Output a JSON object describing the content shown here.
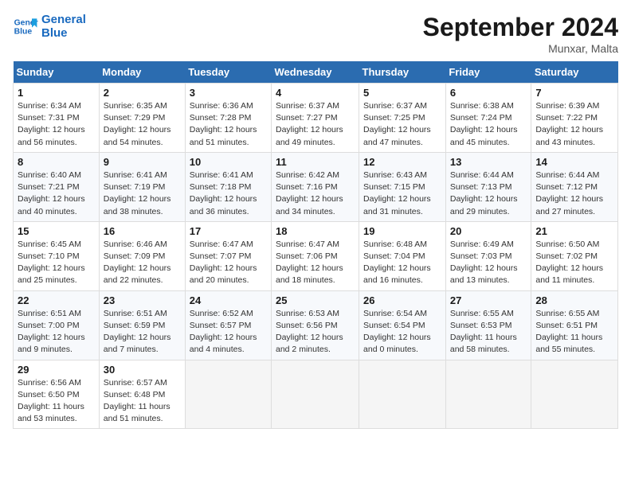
{
  "logo": {
    "line1": "General",
    "line2": "Blue"
  },
  "title": "September 2024",
  "location": "Munxar, Malta",
  "days_of_week": [
    "Sunday",
    "Monday",
    "Tuesday",
    "Wednesday",
    "Thursday",
    "Friday",
    "Saturday"
  ],
  "weeks": [
    [
      {
        "day": "1",
        "sunrise": "6:34 AM",
        "sunset": "7:31 PM",
        "daylight": "12 hours and 56 minutes."
      },
      {
        "day": "2",
        "sunrise": "6:35 AM",
        "sunset": "7:29 PM",
        "daylight": "12 hours and 54 minutes."
      },
      {
        "day": "3",
        "sunrise": "6:36 AM",
        "sunset": "7:28 PM",
        "daylight": "12 hours and 51 minutes."
      },
      {
        "day": "4",
        "sunrise": "6:37 AM",
        "sunset": "7:27 PM",
        "daylight": "12 hours and 49 minutes."
      },
      {
        "day": "5",
        "sunrise": "6:37 AM",
        "sunset": "7:25 PM",
        "daylight": "12 hours and 47 minutes."
      },
      {
        "day": "6",
        "sunrise": "6:38 AM",
        "sunset": "7:24 PM",
        "daylight": "12 hours and 45 minutes."
      },
      {
        "day": "7",
        "sunrise": "6:39 AM",
        "sunset": "7:22 PM",
        "daylight": "12 hours and 43 minutes."
      }
    ],
    [
      {
        "day": "8",
        "sunrise": "6:40 AM",
        "sunset": "7:21 PM",
        "daylight": "12 hours and 40 minutes."
      },
      {
        "day": "9",
        "sunrise": "6:41 AM",
        "sunset": "7:19 PM",
        "daylight": "12 hours and 38 minutes."
      },
      {
        "day": "10",
        "sunrise": "6:41 AM",
        "sunset": "7:18 PM",
        "daylight": "12 hours and 36 minutes."
      },
      {
        "day": "11",
        "sunrise": "6:42 AM",
        "sunset": "7:16 PM",
        "daylight": "12 hours and 34 minutes."
      },
      {
        "day": "12",
        "sunrise": "6:43 AM",
        "sunset": "7:15 PM",
        "daylight": "12 hours and 31 minutes."
      },
      {
        "day": "13",
        "sunrise": "6:44 AM",
        "sunset": "7:13 PM",
        "daylight": "12 hours and 29 minutes."
      },
      {
        "day": "14",
        "sunrise": "6:44 AM",
        "sunset": "7:12 PM",
        "daylight": "12 hours and 27 minutes."
      }
    ],
    [
      {
        "day": "15",
        "sunrise": "6:45 AM",
        "sunset": "7:10 PM",
        "daylight": "12 hours and 25 minutes."
      },
      {
        "day": "16",
        "sunrise": "6:46 AM",
        "sunset": "7:09 PM",
        "daylight": "12 hours and 22 minutes."
      },
      {
        "day": "17",
        "sunrise": "6:47 AM",
        "sunset": "7:07 PM",
        "daylight": "12 hours and 20 minutes."
      },
      {
        "day": "18",
        "sunrise": "6:47 AM",
        "sunset": "7:06 PM",
        "daylight": "12 hours and 18 minutes."
      },
      {
        "day": "19",
        "sunrise": "6:48 AM",
        "sunset": "7:04 PM",
        "daylight": "12 hours and 16 minutes."
      },
      {
        "day": "20",
        "sunrise": "6:49 AM",
        "sunset": "7:03 PM",
        "daylight": "12 hours and 13 minutes."
      },
      {
        "day": "21",
        "sunrise": "6:50 AM",
        "sunset": "7:02 PM",
        "daylight": "12 hours and 11 minutes."
      }
    ],
    [
      {
        "day": "22",
        "sunrise": "6:51 AM",
        "sunset": "7:00 PM",
        "daylight": "12 hours and 9 minutes."
      },
      {
        "day": "23",
        "sunrise": "6:51 AM",
        "sunset": "6:59 PM",
        "daylight": "12 hours and 7 minutes."
      },
      {
        "day": "24",
        "sunrise": "6:52 AM",
        "sunset": "6:57 PM",
        "daylight": "12 hours and 4 minutes."
      },
      {
        "day": "25",
        "sunrise": "6:53 AM",
        "sunset": "6:56 PM",
        "daylight": "12 hours and 2 minutes."
      },
      {
        "day": "26",
        "sunrise": "6:54 AM",
        "sunset": "6:54 PM",
        "daylight": "12 hours and 0 minutes."
      },
      {
        "day": "27",
        "sunrise": "6:55 AM",
        "sunset": "6:53 PM",
        "daylight": "11 hours and 58 minutes."
      },
      {
        "day": "28",
        "sunrise": "6:55 AM",
        "sunset": "6:51 PM",
        "daylight": "11 hours and 55 minutes."
      }
    ],
    [
      {
        "day": "29",
        "sunrise": "6:56 AM",
        "sunset": "6:50 PM",
        "daylight": "11 hours and 53 minutes."
      },
      {
        "day": "30",
        "sunrise": "6:57 AM",
        "sunset": "6:48 PM",
        "daylight": "11 hours and 51 minutes."
      },
      null,
      null,
      null,
      null,
      null
    ]
  ]
}
